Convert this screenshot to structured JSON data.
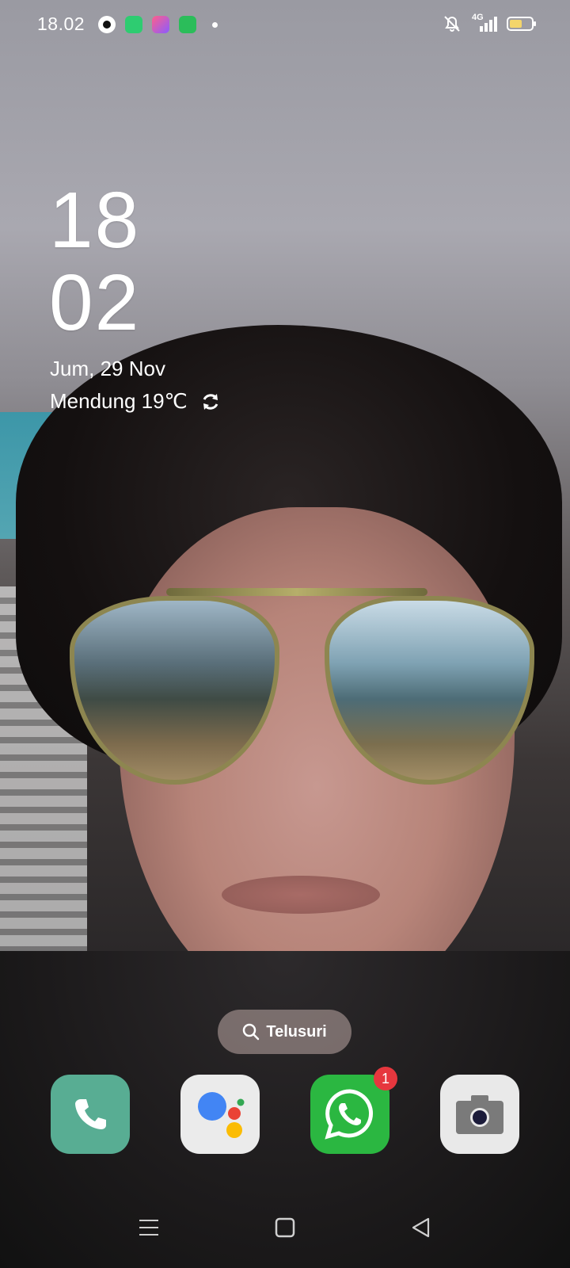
{
  "status_bar": {
    "time": "18.02",
    "notification_icons": [
      "tiktok-icon",
      "messages-icon",
      "theme-store-icon",
      "app-market-icon",
      "more-notifications-dot"
    ],
    "network": "4G",
    "battery_level": 0.6,
    "status_icons": [
      "alarm-off-icon",
      "signal-4g-icon",
      "battery-icon"
    ]
  },
  "lock_clock": {
    "hour": "18",
    "minute": "02",
    "date": "Jum, 29 Nov",
    "weather": "Mendung 19℃"
  },
  "search": {
    "label": "Telusuri"
  },
  "dock": [
    {
      "name": "phone",
      "icon": "phone-icon",
      "color": "#58ad93"
    },
    {
      "name": "google-assistant",
      "icon": "google-assistant-icon",
      "color": "#ebebeb"
    },
    {
      "name": "whatsapp",
      "icon": "whatsapp-icon",
      "color": "#2bb741",
      "badge": "1"
    },
    {
      "name": "camera",
      "icon": "camera-icon",
      "color": "#e9e9e9"
    }
  ],
  "nav_bar": [
    "menu-icon",
    "home-icon",
    "back-icon"
  ]
}
